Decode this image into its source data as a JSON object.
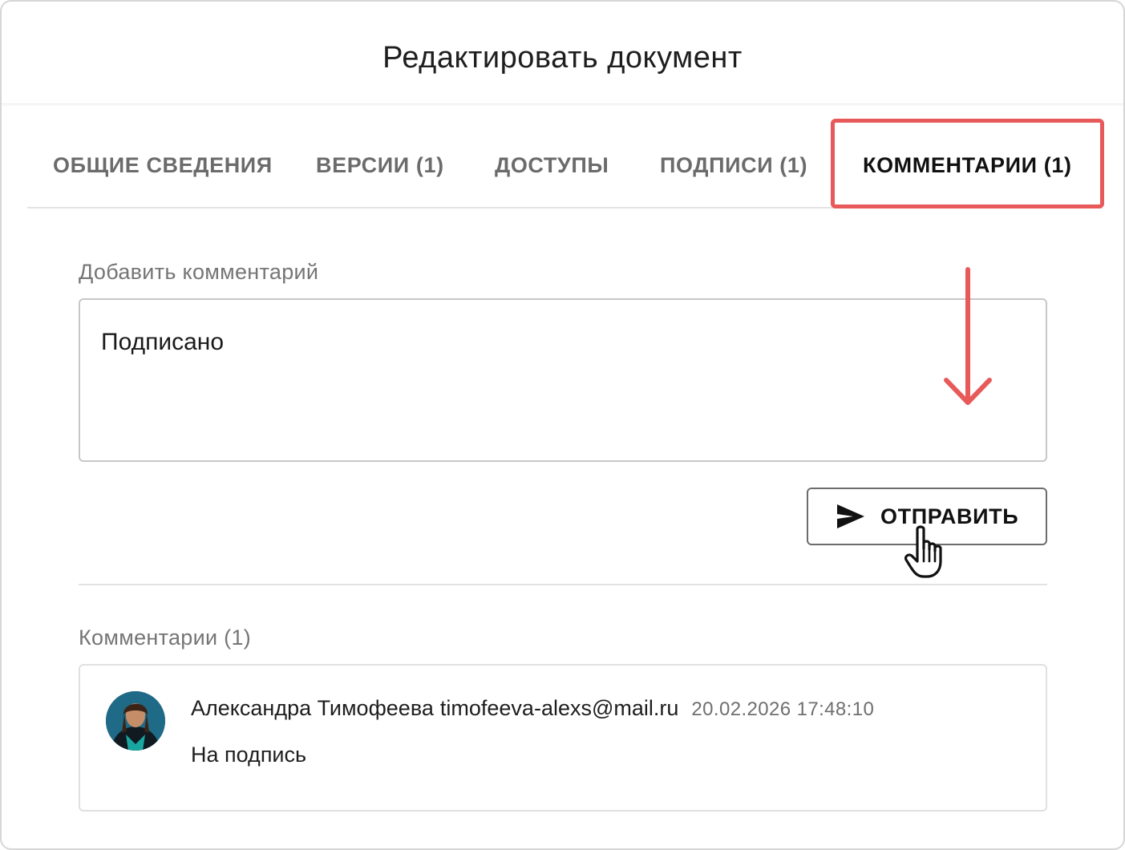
{
  "dialog": {
    "title": "Редактировать документ"
  },
  "tabs": [
    {
      "label": "ОБЩИЕ СВЕДЕНИЯ",
      "active": false
    },
    {
      "label": "ВЕРСИИ (1)",
      "active": false
    },
    {
      "label": "ДОСТУПЫ",
      "active": false
    },
    {
      "label": "ПОДПИСИ (1)",
      "active": false
    },
    {
      "label": "КОММЕНТАРИИ (1)",
      "active": true
    }
  ],
  "add_comment": {
    "label": "Добавить комментарий",
    "value": "Подписано",
    "send_label": "ОТПРАВИТЬ",
    "send_icon": "send-icon"
  },
  "comments": {
    "label": "Комментарии (1)",
    "items": [
      {
        "author": "Александра Тимофеева",
        "email": "timofeeva-alexs@mail.ru",
        "time": "20.02.2026 17:48:10",
        "text": "На подпись",
        "avatar": "avatar-photo"
      }
    ]
  },
  "annotations": {
    "highlight_color": "#e85a5a",
    "arrow_icon": "arrow-down-icon",
    "cursor_icon": "hand-pointer-icon"
  }
}
